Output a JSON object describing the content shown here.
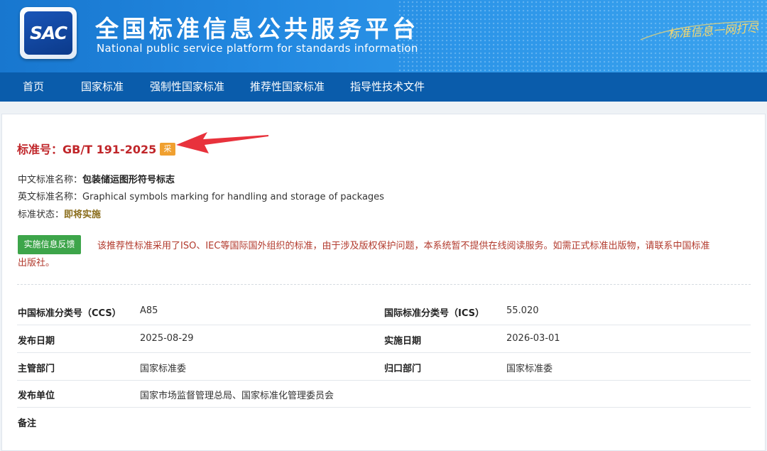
{
  "header": {
    "logo_text": "SAC",
    "title_cn": "全国标准信息公共服务平台",
    "title_en": "National public service platform  for standards information",
    "slogan": "标准信息一网打尽"
  },
  "nav": [
    "首页",
    "国家标准",
    "强制性国家标准",
    "推荐性国家标准",
    "指导性技术文件"
  ],
  "standard": {
    "number_label": "标准号：GB/T 191-2025",
    "badge": "采",
    "cn_name_label": "中文标准名称：",
    "cn_name": "包装储运图形符号标志",
    "en_name_label": "英文标准名称：",
    "en_name": "Graphical symbols marking for handling and storage of packages",
    "status_label": "标准状态：",
    "status": "即将实施"
  },
  "feedback_button": "实施信息反馈",
  "notice": "该推荐性标准采用了ISO、IEC等国际国外组织的标准，由于涉及版权保护问题，本系统暂不提供在线阅读服务。如需正式标准出版物，请联系中国标准出版社。",
  "details": {
    "ccs_label": "中国标准分类号（CCS）",
    "ccs": "A85",
    "ics_label": "国际标准分类号（ICS）",
    "ics": "55.020",
    "publish_date_label": "发布日期",
    "publish_date": "2025-08-29",
    "implement_date_label": "实施日期",
    "implement_date": "2026-03-01",
    "authority_label": "主管部门",
    "authority": "国家标准委",
    "centralized_label": "归口部门",
    "centralized": "国家标准委",
    "issuer_label": "发布单位",
    "issuer": "国家市场监督管理总局、国家标准化管理委员会",
    "remark_label": "备注"
  },
  "colors": {
    "header_blue": "#1877cf",
    "nav_blue": "#0a5cab",
    "standard_red": "#c0262a",
    "badge_orange": "#f0a030",
    "button_green": "#3da54a",
    "notice_red": "#b23a2d",
    "arrow_red": "#e8323c"
  }
}
